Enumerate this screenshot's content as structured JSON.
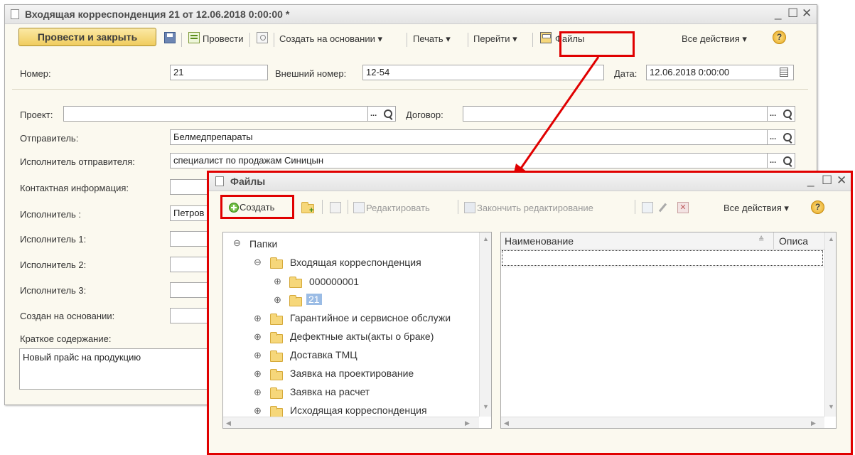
{
  "main_window": {
    "title": "Входящая корреспонденция 21 от 12.06.2018 0:00:00 *",
    "toolbar": {
      "post_close": "Провести и закрыть",
      "post": "Провести",
      "create_based": "Создать на основании ▾",
      "print": "Печать ▾",
      "goto": "Перейти ▾",
      "files": "Файлы",
      "all_actions": "Все действия ▾"
    },
    "fields": {
      "number_label": "Номер:",
      "number_value": "21",
      "ext_number_label": "Внешний номер:",
      "ext_number_value": "12-54",
      "date_label": "Дата:",
      "date_value": "12.06.2018 0:00:00",
      "project_label": "Проект:",
      "project_value": "",
      "contract_label": "Договор:",
      "contract_value": "",
      "sender_label": "Отправитель:",
      "sender_value": "Белмедпрепараты",
      "sender_exec_label": "Исполнитель отправителя:",
      "sender_exec_value": "специалист по продажам Синицын",
      "contact_label": "Контактная информация:",
      "contact_value": "",
      "executor_label": "Исполнитель :",
      "executor_value": "Петров",
      "executor1_label": "Исполнитель 1:",
      "executor2_label": "Исполнитель 2:",
      "executor3_label": "Исполнитель 3:",
      "created_based_label": "Создан на основании:",
      "summary_label": "Краткое содержание:",
      "summary_value": "Новый прайс на продукцию"
    }
  },
  "files_window": {
    "title": "Файлы",
    "toolbar": {
      "create": "Создать",
      "edit": "Редактировать",
      "finish_edit": "Закончить редактирование",
      "all_actions": "Все действия ▾"
    },
    "tree": {
      "root": "Папки",
      "items": [
        {
          "label": "Входящая корреспонденция",
          "level": 1,
          "state": "expanded"
        },
        {
          "label": "000000001",
          "level": 2,
          "state": "collapsed"
        },
        {
          "label": "21",
          "level": 2,
          "state": "collapsed",
          "selected": true
        },
        {
          "label": "Гарантийное и сервисное обслужи",
          "level": 1,
          "state": "collapsed"
        },
        {
          "label": "Дефектные акты(акты о браке)",
          "level": 1,
          "state": "collapsed"
        },
        {
          "label": "Доставка ТМЦ",
          "level": 1,
          "state": "collapsed"
        },
        {
          "label": "Заявка на проектирование",
          "level": 1,
          "state": "collapsed"
        },
        {
          "label": "Заявка на расчет",
          "level": 1,
          "state": "collapsed"
        },
        {
          "label": "Исходящая корреспонденция",
          "level": 1,
          "state": "collapsed"
        }
      ]
    },
    "list": {
      "columns": [
        "Наименование",
        "Описа"
      ]
    }
  },
  "colors": {
    "highlight": "#e00000",
    "window_bg": "#fbf9ef",
    "primary_button": "#f0cc5d",
    "selection": "#9bbce5",
    "arrow": "#e00000"
  }
}
